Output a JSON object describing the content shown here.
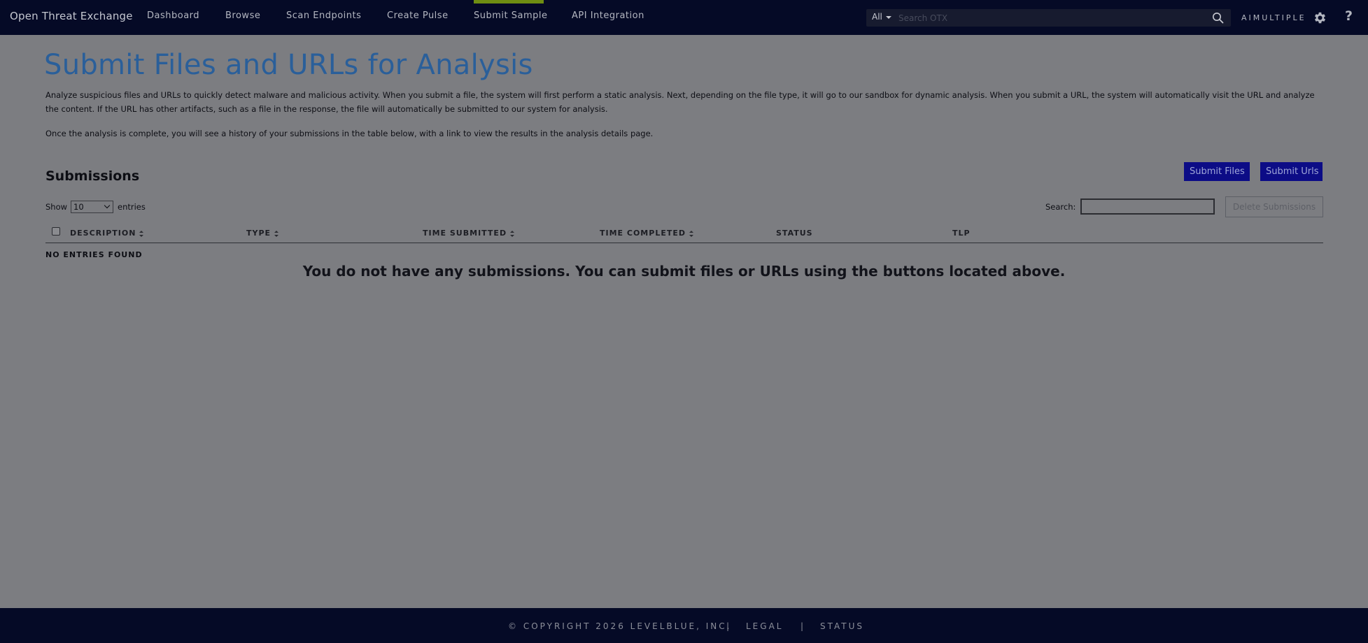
{
  "topbar": {
    "brand": "Open Threat Exchange",
    "nav": [
      "Dashboard",
      "Browse",
      "Scan Endpoints",
      "Create Pulse",
      "Submit Sample",
      "API Integration"
    ],
    "active_nav": "Submit Sample",
    "search_scope": "All",
    "search_placeholder": "Search OTX",
    "user": "AIMULTIPLE",
    "help": "?"
  },
  "main": {
    "title": "Submit Files and URLs for Analysis",
    "intro": "Analyze suspicious files and URLs to quickly detect malware and malicious activity. When you submit a file, the system will first perform a static analysis. Next, depending on the file type, it will go to our sandbox for dynamic analysis. When you submit a URL, the system will automatically visit the URL and analyze the content. If the URL has other artifacts, such as a file in the response, the file will automatically be submitted to our system for analysis.",
    "intro2": "Once the analysis is complete, you will see a history of your submissions in the table below, with a link to view the results in the analysis details page.",
    "section_title": "Submissions",
    "submit_files_label": "Submit Files",
    "submit_urls_label": "Submit Urls",
    "show_label": "Show",
    "entries_value": "10",
    "entries_label": "entries",
    "search_label": "Search:",
    "delete_label": "Delete Submissions",
    "columns": [
      "DESCRIPTION",
      "TYPE",
      "TIME SUBMITTED",
      "TIME COMPLETED",
      "STATUS",
      "TLP"
    ],
    "no_entries": "NO ENTRIES FOUND",
    "empty_message": "You do not have any submissions. You can submit files or URLs using the buttons located above."
  },
  "footer": {
    "copyright": "© COPYRIGHT 2026 LEVELBLUE, INC.",
    "separator": "|",
    "legal": "LEGAL",
    "status": "STATUS"
  },
  "colors": {
    "topbar_bg": "#050a26",
    "page_bg": "#7c7d81",
    "title": "#2a5f9a",
    "active_tab": "#6f8e12",
    "button_bg": "#0c0c86"
  }
}
